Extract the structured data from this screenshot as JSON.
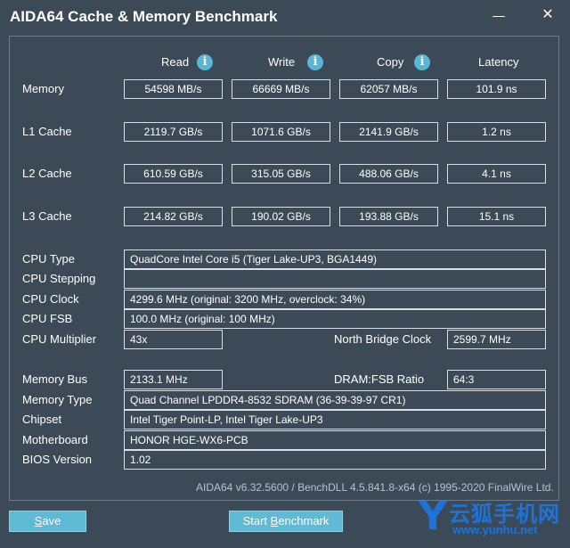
{
  "window": {
    "title": "AIDA64 Cache & Memory Benchmark",
    "minimize": "—",
    "close": "✕"
  },
  "columns": {
    "read": "Read",
    "write": "Write",
    "copy": "Copy",
    "latency": "Latency",
    "info_glyph": "i"
  },
  "rows": [
    {
      "label": "Memory",
      "read": "54598 MB/s",
      "write": "66669 MB/s",
      "copy": "62057 MB/s",
      "latency": "101.9 ns"
    },
    {
      "label": "L1 Cache",
      "read": "2119.7 GB/s",
      "write": "1071.6 GB/s",
      "copy": "2141.9 GB/s",
      "latency": "1.2 ns"
    },
    {
      "label": "L2 Cache",
      "read": "610.59 GB/s",
      "write": "315.05 GB/s",
      "copy": "488.06 GB/s",
      "latency": "4.1 ns"
    },
    {
      "label": "L3 Cache",
      "read": "214.82 GB/s",
      "write": "190.02 GB/s",
      "copy": "193.88 GB/s",
      "latency": "15.1 ns"
    }
  ],
  "cpu": {
    "type_label": "CPU Type",
    "type": "QuadCore Intel Core i5  (Tiger Lake-UP3, BGA1449)",
    "stepping_label": "CPU Stepping",
    "stepping": "",
    "clock_label": "CPU Clock",
    "clock": "4299.6 MHz  (original: 3200 MHz, overclock: 34%)",
    "fsb_label": "CPU FSB",
    "fsb": "100.0 MHz  (original: 100 MHz)",
    "multiplier_label": "CPU Multiplier",
    "multiplier": "43x",
    "nb_clock_label": "North Bridge Clock",
    "nb_clock": "2599.7 MHz"
  },
  "system": {
    "mem_bus_label": "Memory Bus",
    "mem_bus": "2133.1 MHz",
    "dram_fsb_label": "DRAM:FSB Ratio",
    "dram_fsb": "64:3",
    "mem_type_label": "Memory Type",
    "mem_type": "Quad Channel LPDDR4-8532 SDRAM  (36-39-39-97 CR1)",
    "chipset_label": "Chipset",
    "chipset": "Intel Tiger Point-LP, Intel Tiger Lake-UP3",
    "motherboard_label": "Motherboard",
    "motherboard": "HONOR HGE-WX6-PCB",
    "bios_label": "BIOS Version",
    "bios": "1.02"
  },
  "footer": "AIDA64 v6.32.5600 / BenchDLL 4.5.841.8-x64  (c) 1995-2020 FinalWire Ltd.",
  "buttons": {
    "save_mnemonic": "S",
    "save_rest": "ave",
    "start_prefix": "Start ",
    "start_mnemonic": "B",
    "start_rest": "enchmark"
  },
  "watermark": {
    "letter": "Y",
    "text": "云狐手机网",
    "url": "www.yunhu.net"
  }
}
